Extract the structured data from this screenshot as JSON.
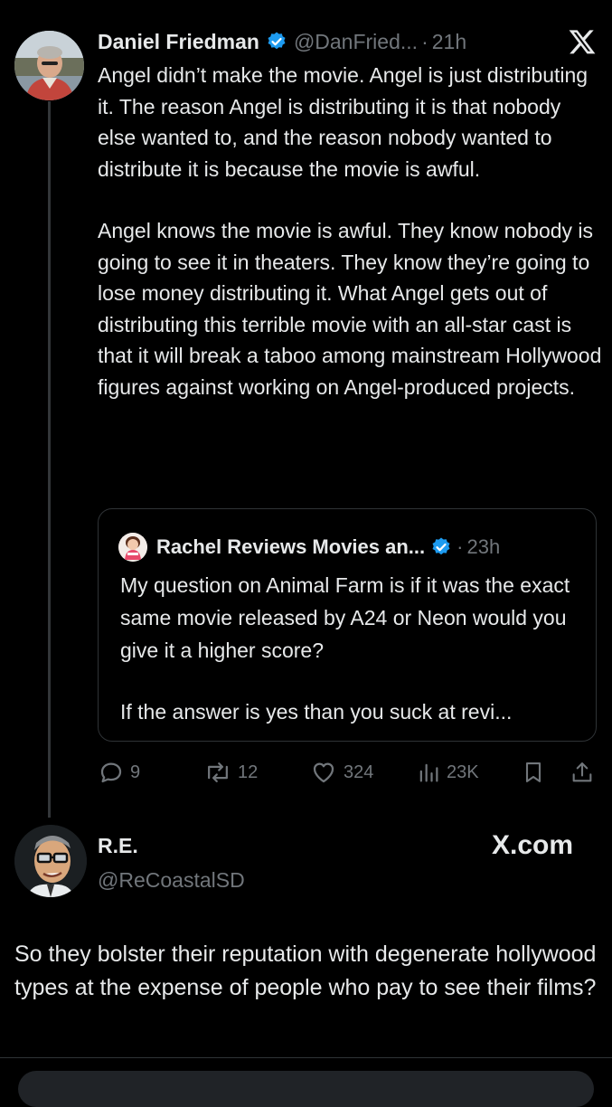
{
  "main_tweet": {
    "author_name": "Daniel Friedman",
    "author_handle": "@DanFried...",
    "separator": "·",
    "time": "21h",
    "paragraphs": [
      "Angel didn’t make the movie.  Angel is just distributing it. The reason Angel is distributing it is that nobody else wanted to, and the reason nobody wanted to distribute it is because the movie is awful.",
      "Angel knows the movie is awful.  They know nobody is going to see it in theaters. They know they’re going to lose money distributing it.  What Angel gets out of distributing this terrible movie with an all-star cast is that it will break a taboo among mainstream Hollywood figures against working on Angel-produced projects."
    ],
    "verified_icon": "verified-badge-icon",
    "x_logo_icon": "x-logo-icon",
    "quoted": {
      "author_name": "Rachel Reviews Movies an...",
      "separator": "·",
      "time": "23h",
      "paragraphs": [
        "My question on Animal Farm is if it was the exact same movie released by A24 or Neon would you give it a higher score?",
        "If the answer is yes than you suck at revi..."
      ]
    },
    "actions": {
      "replies": "9",
      "reposts": "12",
      "likes": "324",
      "views": "23K"
    }
  },
  "reply": {
    "author_name": "R.E.",
    "author_handle": "@ReCoastalSD",
    "watermark": "X.com",
    "text": "So they bolster their reputation with degenerate hollywood types at the expense of people who pay to see their films?"
  },
  "colors": {
    "background": "#000000",
    "text": "#e7e9ea",
    "muted": "#71767b",
    "verified": "#1d9bf0",
    "border": "#2f3336"
  }
}
